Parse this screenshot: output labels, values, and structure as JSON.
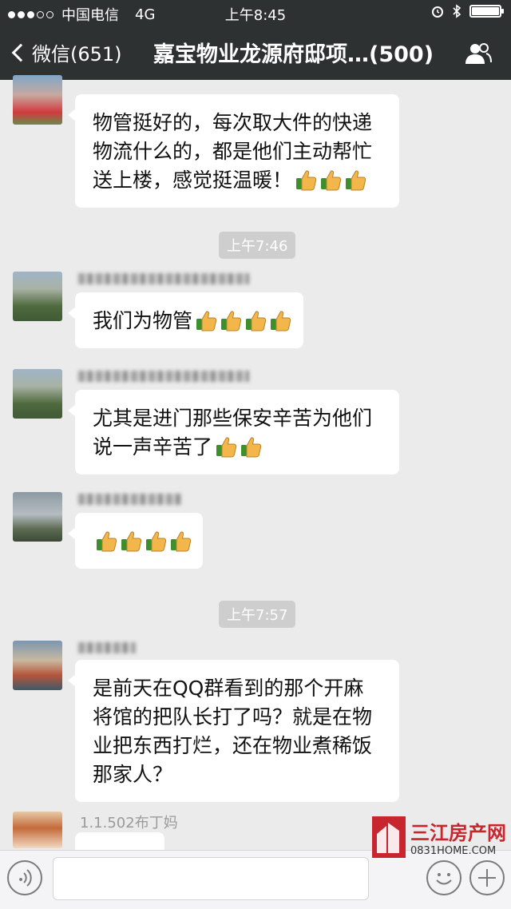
{
  "status_bar": {
    "carrier": "中国电信",
    "network": "4G",
    "time": "上午8:45"
  },
  "nav": {
    "back_label": "微信(651)",
    "title": "嘉宝物业龙源府邸项…(500)"
  },
  "messages": [
    {
      "text_lines": [
        "物管挺好的，每次取大件的快递",
        "物流什么的，都是他们主动帮忙",
        "送上楼，感觉挺温暖！"
      ],
      "thumbs": 3
    },
    {
      "timestamp": "上午7:46"
    },
    {
      "text_lines": [
        "我们为物管"
      ],
      "thumbs": 4
    },
    {
      "text_lines": [
        "尤其是进门那些保安辛苦为他们",
        "说一声辛苦了"
      ],
      "thumbs": 2
    },
    {
      "text_lines": [
        ""
      ],
      "thumbs": 4
    },
    {
      "timestamp": "上午7:57"
    },
    {
      "text_lines": [
        "是前天在QQ群看到的那个开麻",
        "将馆的把队长打了吗？就是在物",
        "业把东西打烂，还在物业煮稀饭",
        "那家人？"
      ]
    },
    {
      "sender": "1.1.502布丁妈"
    }
  ],
  "watermark": {
    "name": "三江房产网",
    "url": "0831HOME.COM"
  },
  "icons": {
    "back": "chevron-left-icon",
    "group": "group-members-icon",
    "voice": "voice-icon",
    "emoji": "emoji-icon",
    "plus": "plus-icon",
    "thumbs": "thumbs-up-icon"
  }
}
